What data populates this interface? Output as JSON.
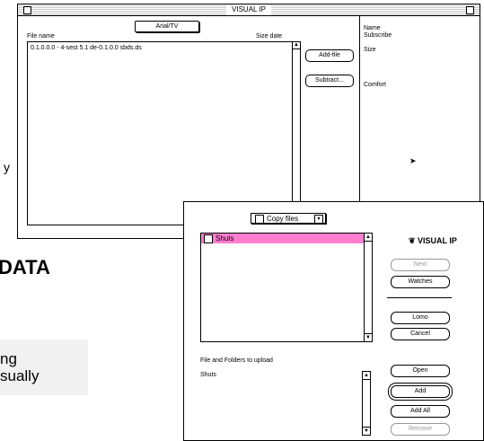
{
  "background": {
    "heading_fragment": "DATA",
    "box_line1": "ng",
    "box_line2": "sually",
    "tail_char": "y"
  },
  "back_window": {
    "title": "VISUAL IP",
    "popup": "Arial/TV",
    "col_name": "File name",
    "col_size": "Size date",
    "row1": "0.1.0.0.0 - 4-sest   5.1   de-0.1.0.0  sbds.ds",
    "btn1": "Add-file",
    "btn2": "Subtract...",
    "right": {
      "line1": "Name",
      "line2": "Subscribe",
      "line3": "Size",
      "line4": "Comfort"
    }
  },
  "dialog": {
    "popup": "Copy files",
    "selected_item": "Shuts",
    "logo": "VISUAL IP",
    "buttons": {
      "b1": "Next",
      "b2": "Watches",
      "b3": "Lomo",
      "b4": "Cancel",
      "b5": "Open",
      "b6": "Add",
      "b7": "Add All",
      "b8": "Remove"
    },
    "names_label": "File and Folders to upload",
    "names_item": "Shuts"
  }
}
